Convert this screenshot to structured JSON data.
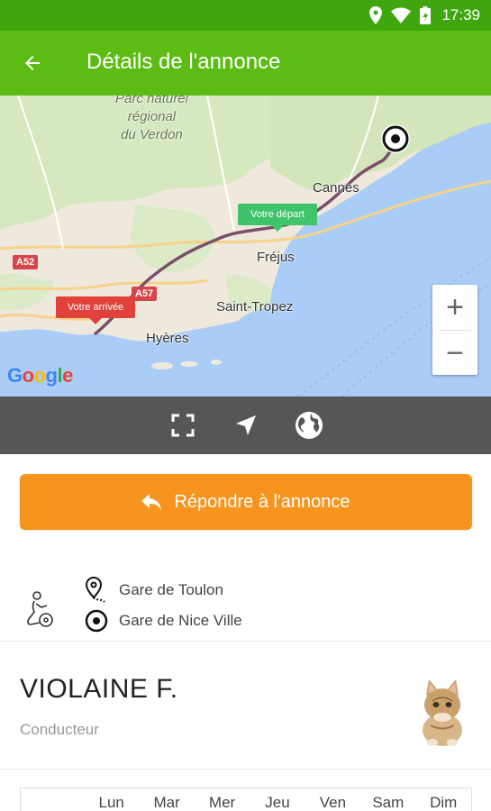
{
  "status_bar": {
    "time": "17:39"
  },
  "app_bar": {
    "title": "Détails de l'annonce"
  },
  "map": {
    "labels": {
      "park_line1": "Parc naturel",
      "park_line2": "régional",
      "park_line3": "du Verdon",
      "cannes": "Cannes",
      "frejus": "Fréjus",
      "saint_tropez": "Saint-Tropez",
      "hyeres": "Hyères",
      "road_a52": "A52",
      "road_a57": "A57"
    },
    "marker_depart": "Votre départ",
    "marker_arrive": "Votre arrivée",
    "zoom_in": "+",
    "zoom_out": "−",
    "google": [
      "G",
      "o",
      "o",
      "g",
      "l",
      "e"
    ],
    "colors": {
      "water": "#a9cdf7",
      "land": "#efe9dd",
      "green": "#cfe5b5",
      "route": "#7a4f6a"
    }
  },
  "map_toolbar": {
    "icons": [
      "fullscreen-icon",
      "navigate-icon",
      "globe-icon"
    ]
  },
  "reply_button": {
    "label": "Répondre à l'annonce"
  },
  "route": {
    "departure": "Gare de Toulon",
    "arrival": "Gare de Nice Ville"
  },
  "driver": {
    "name": "VIOLAINE F.",
    "role": "Conducteur"
  },
  "days": [
    "Lun",
    "Mar",
    "Mer",
    "Jeu",
    "Ven",
    "Sam",
    "Dim"
  ],
  "colors": {
    "primary": "#5cbc14",
    "status": "#3fa60f",
    "accent": "#f7941d",
    "toolbar": "#565656"
  }
}
